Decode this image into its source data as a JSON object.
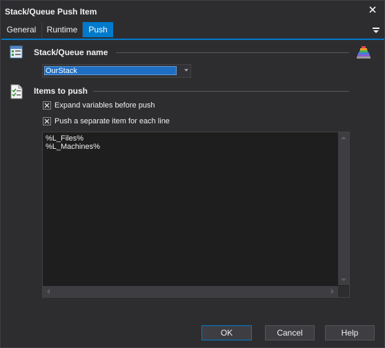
{
  "window": {
    "title": "Stack/Queue Push Item"
  },
  "tabs": [
    {
      "label": "General",
      "active": false
    },
    {
      "label": "Runtime",
      "active": false
    },
    {
      "label": "Push",
      "active": true
    }
  ],
  "stack_section": {
    "label": "Stack/Queue name",
    "selected_value": "OurStack"
  },
  "items_section": {
    "label": "Items to push",
    "checkboxes": [
      {
        "label": "Expand variables before push",
        "checked": true
      },
      {
        "label": "Push a separate item for each line",
        "checked": true
      }
    ],
    "text_content": "%L_Files%\n%L_Machines%"
  },
  "buttons": {
    "ok": "OK",
    "cancel": "Cancel",
    "help": "Help"
  },
  "colors": {
    "accent": "#007acc",
    "background": "#2d2d30",
    "editor_background": "#1e1e1e"
  }
}
